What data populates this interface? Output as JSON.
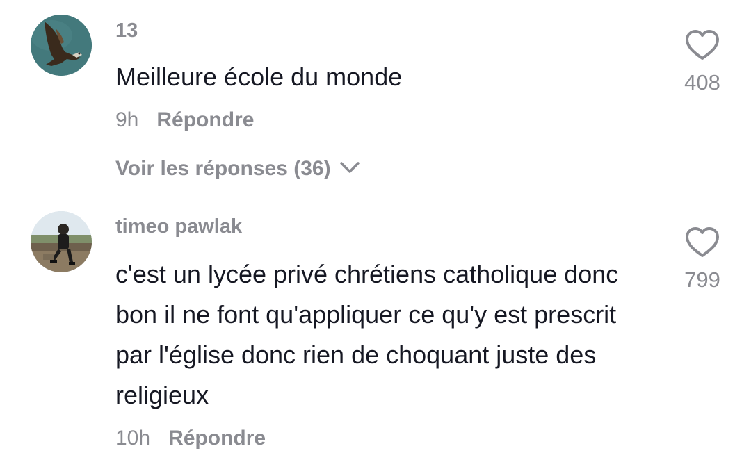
{
  "comments": [
    {
      "username": "13",
      "text": "Meilleure école du monde",
      "time": "9h",
      "reply_label": "Répondre",
      "view_replies_label": "Voir les réponses (36)",
      "likes": "408",
      "avatar_icon": "eagle-avatar"
    },
    {
      "username": "timeo pawlak",
      "text": "c'est un lycée privé chrétiens catholique donc bon il ne font qu'appliquer ce qu'y est prescrit par l'église donc rien de choquant juste des religieux",
      "time": "10h",
      "reply_label": "Répondre",
      "likes": "799",
      "avatar_icon": "person-photo-avatar"
    }
  ],
  "colors": {
    "primary_text": "#161823",
    "secondary_text": "#8a8b91",
    "icon_stroke": "#8a8b91",
    "background": "#ffffff"
  }
}
